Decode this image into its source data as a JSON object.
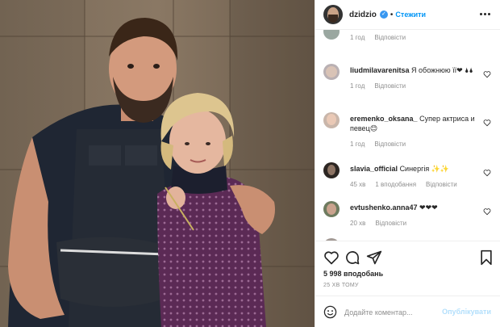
{
  "header": {
    "username": "dzidzio",
    "separator": "•",
    "follow_label": "Стежити"
  },
  "comments": [
    {
      "username": "",
      "text": "",
      "time": "1 год",
      "reply_label": "Відповісти",
      "likes": ""
    },
    {
      "username": "liudmilavarenitsa",
      "text": "Я обожнюю її❤ 🌢🌢",
      "time": "1 год",
      "reply_label": "Відповісти",
      "likes": ""
    },
    {
      "username": "eremenko_oksana_",
      "text": "Супер актриса и певец😊",
      "time": "1 год",
      "reply_label": "Відповісти",
      "likes": ""
    },
    {
      "username": "slavia_official",
      "text": "Синергія ✨✨",
      "time": "45 хв",
      "reply_label": "Відповісти",
      "likes": "1 вподобання"
    },
    {
      "username": "evtushenko.anna47",
      "text": "❤❤❤",
      "time": "20 хв",
      "reply_label": "Відповісти",
      "likes": ""
    }
  ],
  "post": {
    "likes": "5 998 вподобань",
    "time": "25 ХВ ТОМУ"
  },
  "add_comment": {
    "placeholder": "Додайте коментар...",
    "post_label": "Опублікувати"
  },
  "colors": {
    "accent": "#0095f6",
    "verified": "#3897f0",
    "muted": "#8e8e8e",
    "post_disabled": "#b2dffc"
  }
}
